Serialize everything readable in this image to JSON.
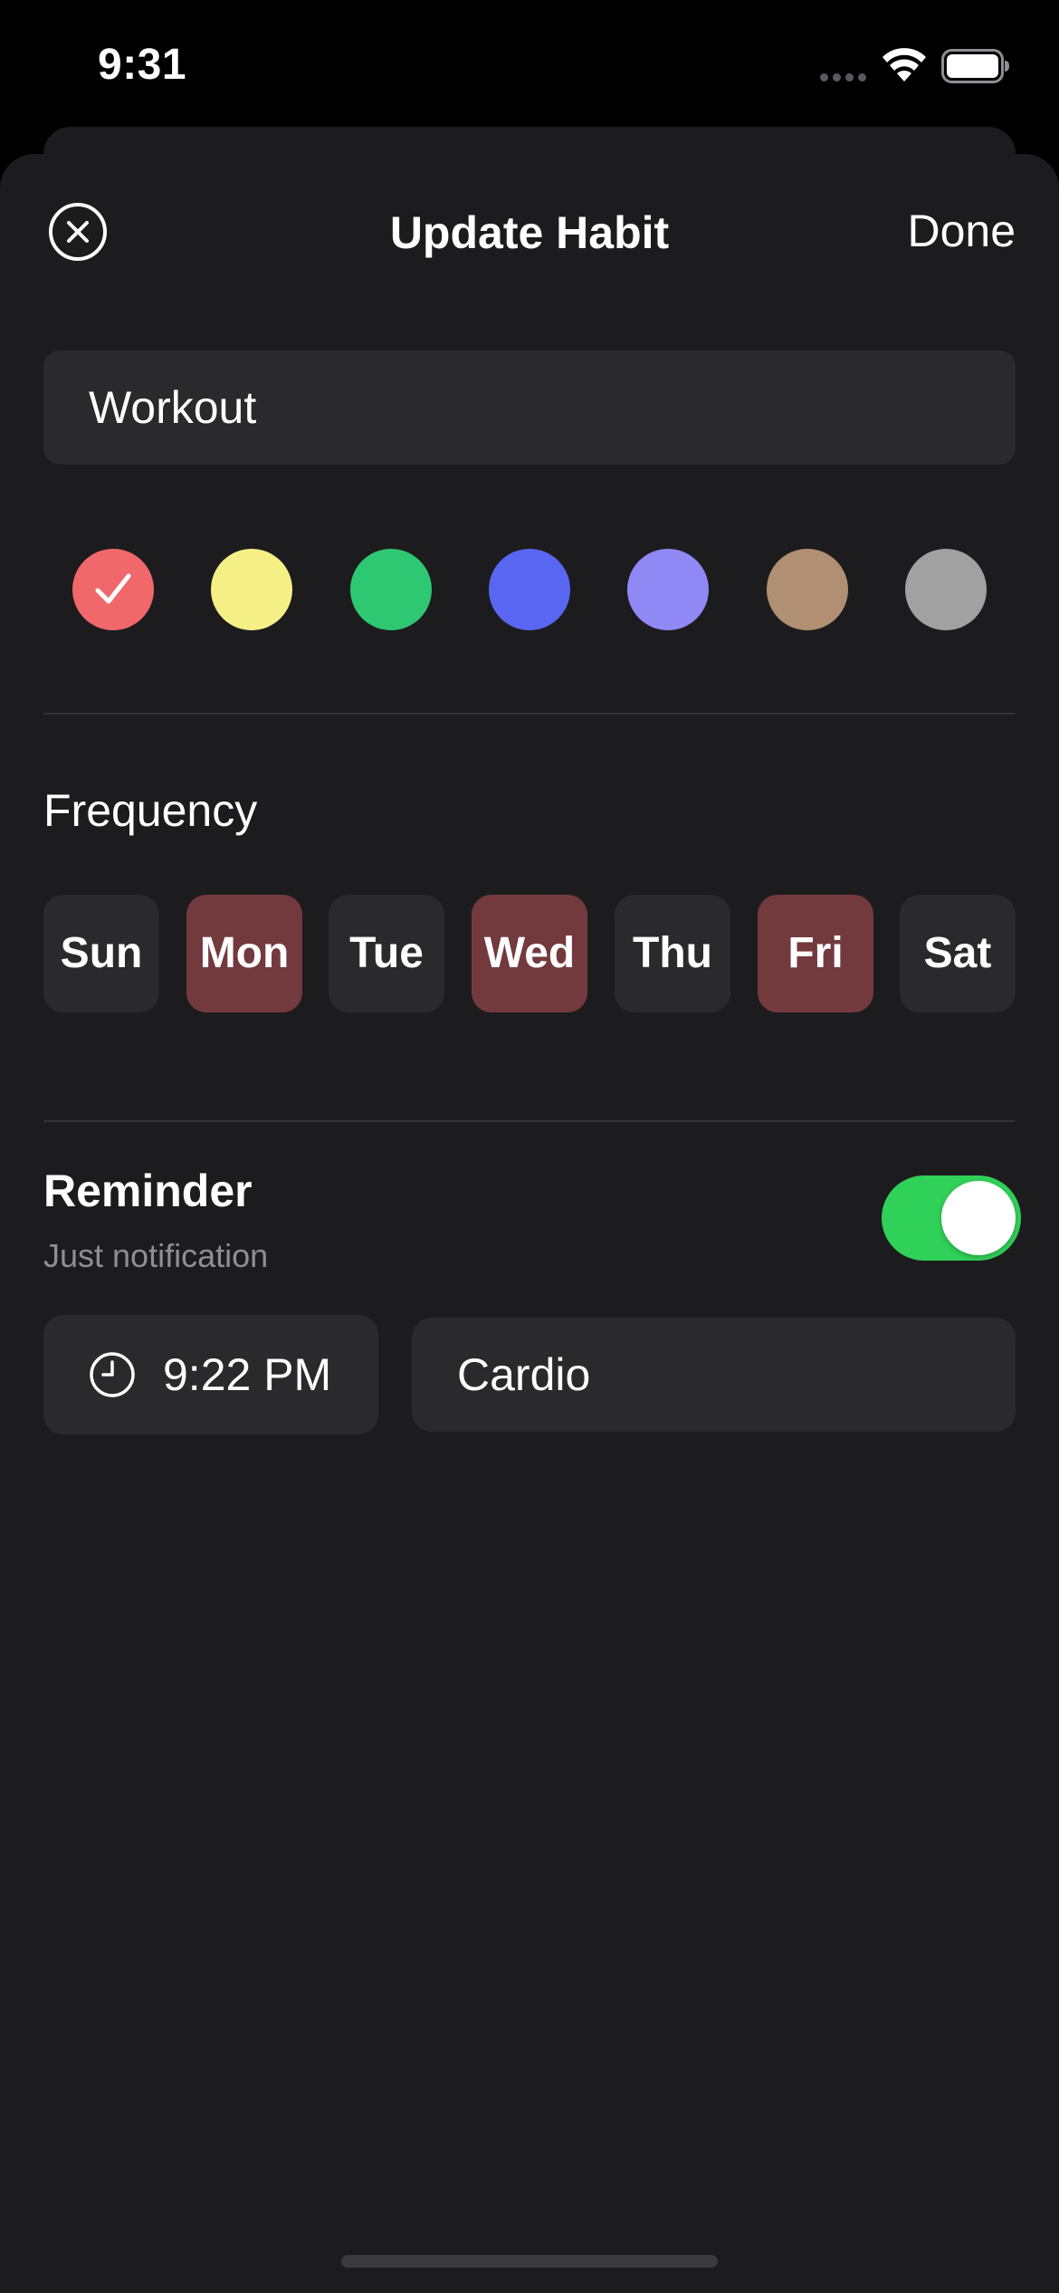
{
  "status_bar": {
    "time": "9:31",
    "icons": [
      "cellular-signal-icon",
      "wifi-icon",
      "battery-icon"
    ]
  },
  "nav": {
    "title": "Update Habit",
    "done_label": "Done",
    "close_icon": "close-circle-icon"
  },
  "habit_name": {
    "value": "Workout"
  },
  "colors": {
    "swatches": [
      "#f0686a",
      "#f5f086",
      "#2ec872",
      "#5866f2",
      "#9088f4",
      "#b08f72",
      "#a1a1a1"
    ],
    "selected_index": 0,
    "check_icon": "checkmark-icon"
  },
  "frequency": {
    "label": "Frequency",
    "days": [
      {
        "label": "Sun",
        "selected": false
      },
      {
        "label": "Mon",
        "selected": true
      },
      {
        "label": "Tue",
        "selected": false
      },
      {
        "label": "Wed",
        "selected": true
      },
      {
        "label": "Thu",
        "selected": false
      },
      {
        "label": "Fri",
        "selected": true
      },
      {
        "label": "Sat",
        "selected": false
      }
    ],
    "selected_color": "#733a3d"
  },
  "reminder": {
    "title": "Reminder",
    "subtitle": "Just notification",
    "enabled": true,
    "toggle_color": "#30d158",
    "time": "9:22 PM",
    "time_icon": "clock-icon",
    "note": "Cardio"
  }
}
